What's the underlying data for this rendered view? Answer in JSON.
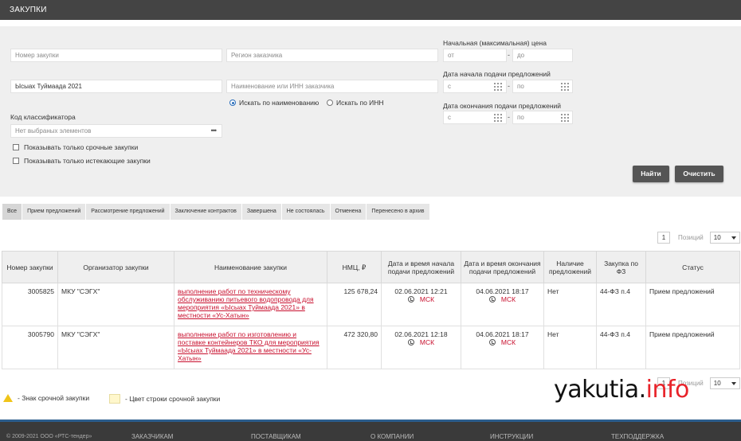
{
  "header": {
    "title": "ЗАКУПКИ"
  },
  "filters": {
    "purchase_number_placeholder": "Номер закупки",
    "customer_region_placeholder": "Регион заказчика",
    "keyword_value": "Ысыах Туймаада 2021",
    "customer_name_placeholder": "Наименование или ИНН заказчика",
    "search_by_name_label": "Искать по наименованию",
    "search_by_inn_label": "Искать по ИНН",
    "classifier_label": "Код классификатора",
    "classifier_placeholder": "Нет выбраных элементов",
    "urgent_only_label": "Показывать только срочные закупки",
    "expiring_only_label": "Показывать только истекающие закупки",
    "price_label": "Начальная (максимальная) цена",
    "price_from_placeholder": "от",
    "price_to_placeholder": "до",
    "start_date_label": "Дата начала подачи предложений",
    "end_date_label": "Дата окончания подачи предложений",
    "date_from_placeholder": "с",
    "date_to_placeholder": "по",
    "range_dash": "-",
    "find_button": "Найти",
    "clear_button": "Очистить"
  },
  "tabs": [
    "Все",
    "Прием предложений",
    "Рассмотрение предложений",
    "Заключение контрактов",
    "Завершена",
    "Не состоялась",
    "Отменена",
    "Перенесено в архив"
  ],
  "pager": {
    "page": "1",
    "per_page_label": "Позиций",
    "per_page": "10"
  },
  "table": {
    "headers": {
      "number": "Номер закупки",
      "organizer": "Организатор закупки",
      "name": "Наименование закупки",
      "price": "НМЦ, ₽",
      "start": "Дата и время начала подачи предложений",
      "end": "Дата и время окончания подачи предложений",
      "offers": "Наличие предложений",
      "law": "Закупка по ФЗ",
      "status": "Статус"
    },
    "rows": [
      {
        "number": "3005825",
        "organizer": "МКУ \"СЭГХ\"",
        "name": "выполнение работ по техническому обслуживанию питьевого водопровода для мероприятия «Ысыах Туймаада 2021» в местности «Ус-Хатын»",
        "price": "125 678,24",
        "start": "02.06.2021 12:21",
        "end": "04.06.2021 18:17",
        "tz": "МСК",
        "offers": "Нет",
        "law": "44-ФЗ п.4",
        "status": "Прием предложений"
      },
      {
        "number": "3005790",
        "organizer": "МКУ \"СЭГХ\"",
        "name": "выполнение работ по изготовлению и поставке контейнеров ТКО для мероприятия «Ысыах Туймаада 2021» в местности «Ус-Хатын»",
        "price": "472 320,80",
        "start": "02.06.2021 12:18",
        "end": "04.06.2021 18:17",
        "tz": "МСК",
        "offers": "Нет",
        "law": "44-ФЗ п.4",
        "status": "Прием предложений"
      }
    ]
  },
  "legend": {
    "urgent_sign": "- Знак срочной закупки",
    "urgent_row_color": "- Цвет строки срочной закупки"
  },
  "watermark": {
    "main": "yakutia.",
    "accent": "info"
  },
  "footer": {
    "copyright": "© 2009-2021 ООО «РТС-тендер»",
    "links": [
      "ЗАКАЗЧИКАМ",
      "ПОСТАВЩИКАМ",
      "О КОМПАНИИ",
      "ИНСТРУКЦИИ",
      "ТЕХПОДДЕРЖКА"
    ]
  },
  "colors": {
    "header_bg": "#444444",
    "filter_bg": "#efefef",
    "link_red": "#c8102e",
    "footer_bg": "#3a3a3a",
    "footer_accent": "#2b5d8c",
    "urgent_row": "#fff7cc"
  },
  "icons": [
    "calendar-icon",
    "clock-icon",
    "warning-icon",
    "ellipsis-icon",
    "chevron-down-icon"
  ]
}
